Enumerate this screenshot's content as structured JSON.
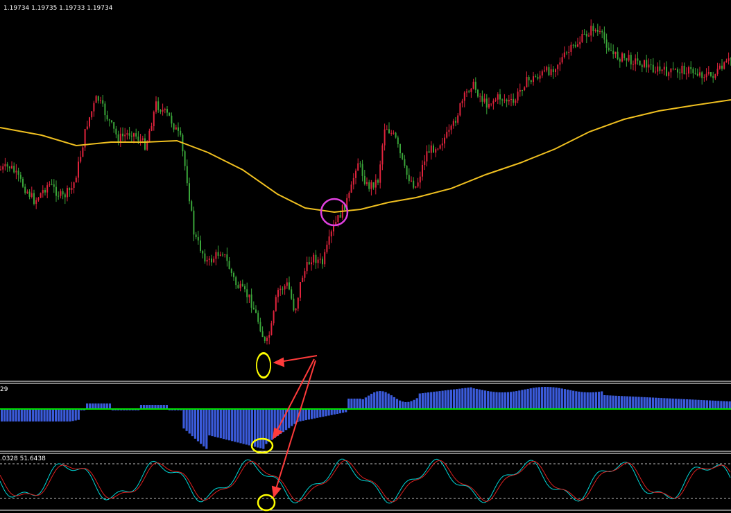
{
  "main_panel": {
    "ohlc_label": "1.19734 1.19735 1.19733 1.19734"
  },
  "histogram_panel": {
    "label": "29"
  },
  "oscillator_panel": {
    "label": ".0328 51.6438"
  },
  "colors": {
    "background": "#000000",
    "bull_candle": "#e0233c",
    "bear_candle": "#3aa63a",
    "moving_average": "#f0c020",
    "histogram": "#3b5bdb",
    "zero_line": "#00e000",
    "stoch_main": "#00d8d8",
    "stoch_signal": "#e02020",
    "marker_yellow": "#ffff00",
    "marker_magenta": "#e040e0",
    "arrow": "#ff3b3b",
    "divider": "#ffffff"
  },
  "chart_data": [
    {
      "type": "candlestick",
      "title": "",
      "moving_average": true,
      "annotations": [
        "yellow circle at price low",
        "magenta circle where price crosses the moving average",
        "red arrows linking the low to the lower indicators"
      ]
    },
    {
      "type": "bar",
      "title": "",
      "zero_line": true
    },
    {
      "type": "line",
      "title": "",
      "series": [
        {
          "values": []
        },
        {
          "values": []
        }
      ],
      "levels": [
        "upper dashed level",
        "lower dashed level"
      ]
    }
  ]
}
